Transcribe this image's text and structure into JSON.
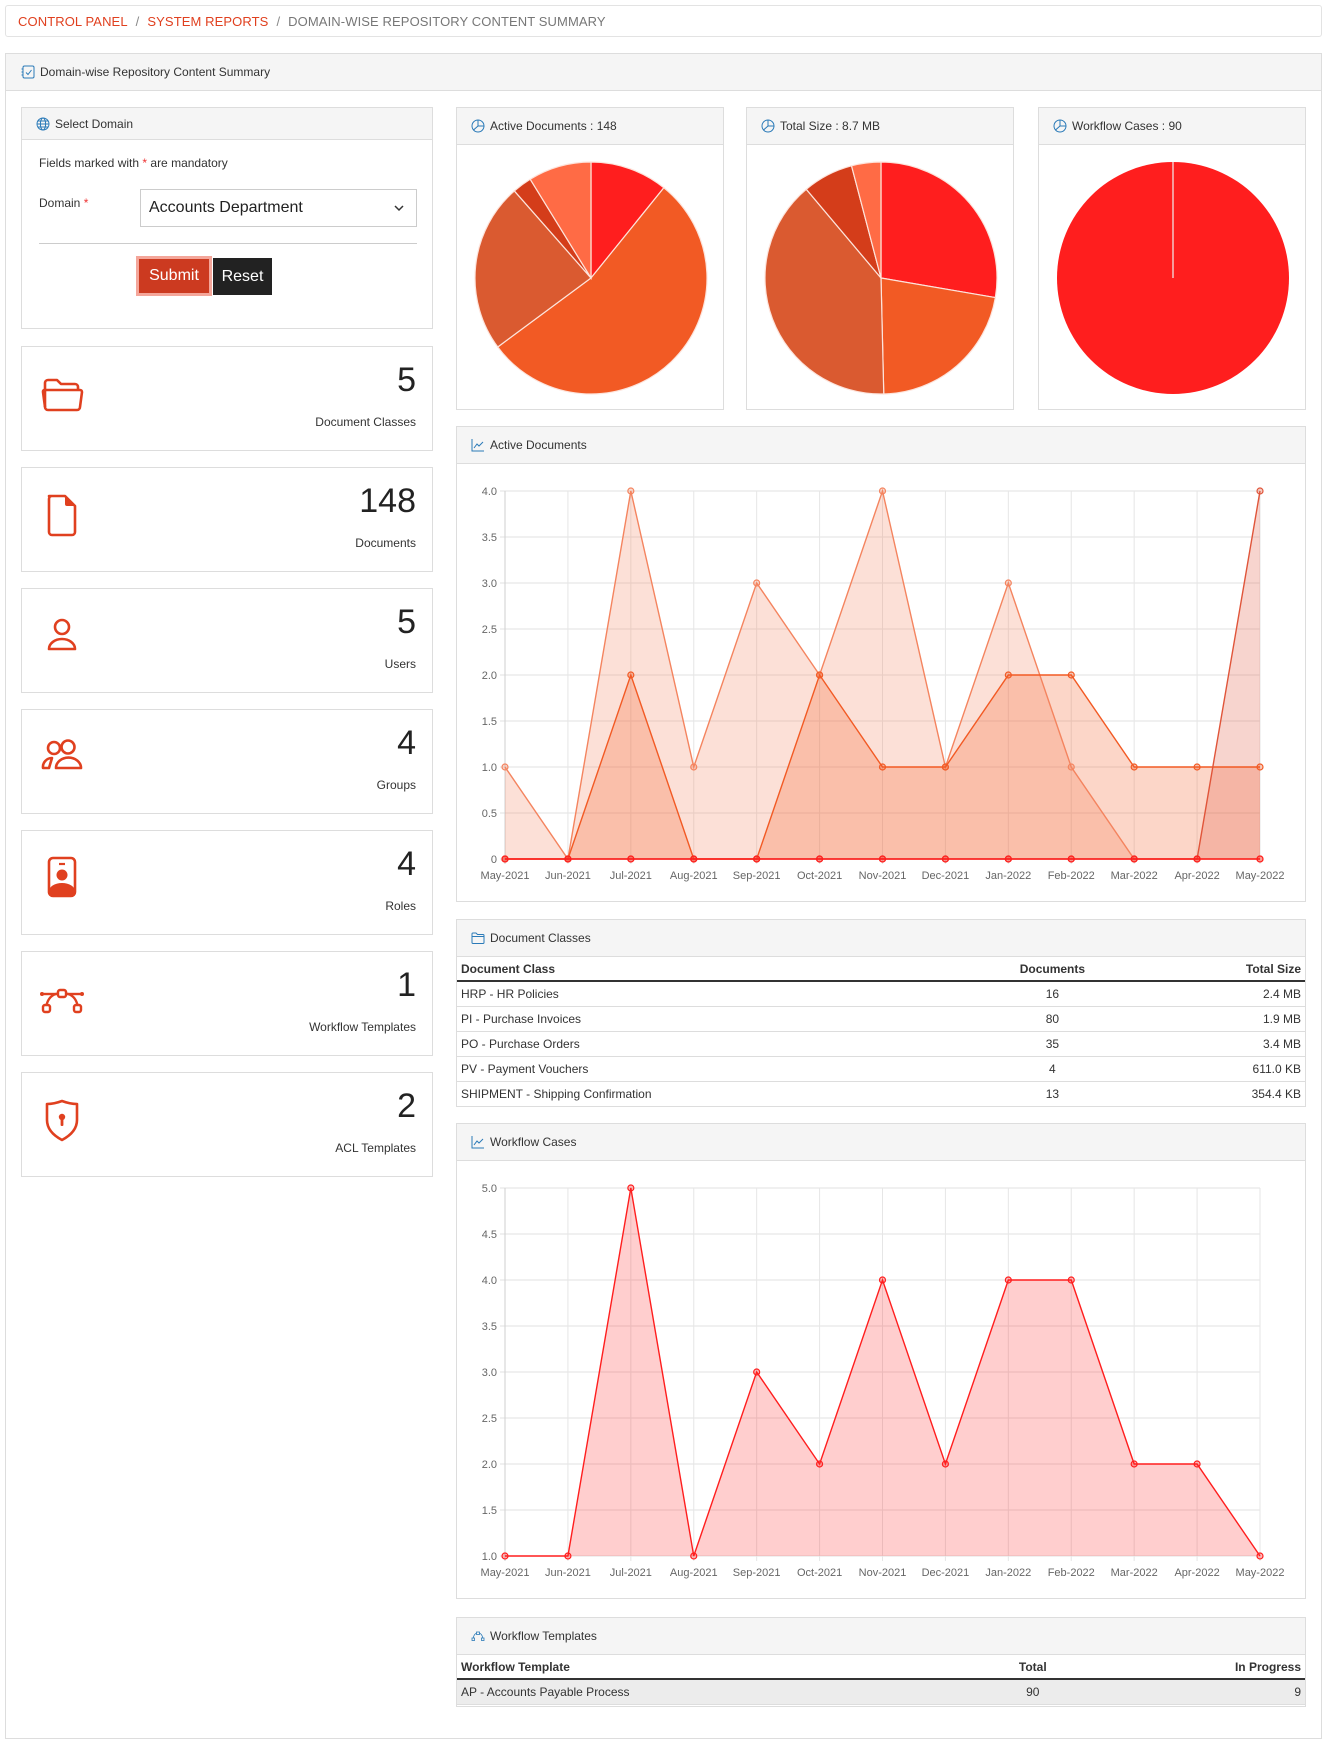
{
  "breadcrumb": {
    "items": [
      "CONTROL PANEL",
      "SYSTEM REPORTS"
    ],
    "current": "DOMAIN-WISE REPOSITORY CONTENT SUMMARY",
    "separator": "/"
  },
  "panel": {
    "title": "Domain-wise Repository Content Summary"
  },
  "domain_form": {
    "title": "Select Domain",
    "mandatory_prefix": "Fields marked with",
    "mandatory_star": "*",
    "mandatory_suffix": "are mandatory",
    "domain_label": "Domain",
    "domain_value": "Accounts Department",
    "submit_label": "Submit",
    "reset_label": "Reset"
  },
  "stats": [
    {
      "icon": "folder-icon",
      "value": "5",
      "label": "Document Classes"
    },
    {
      "icon": "document-icon",
      "value": "148",
      "label": "Documents"
    },
    {
      "icon": "user-icon",
      "value": "5",
      "label": "Users"
    },
    {
      "icon": "group-icon",
      "value": "4",
      "label": "Groups"
    },
    {
      "icon": "role-badge-icon",
      "value": "4",
      "label": "Roles"
    },
    {
      "icon": "workflow-icon",
      "value": "1",
      "label": "Workflow Templates"
    },
    {
      "icon": "shield-lock-icon",
      "value": "2",
      "label": "ACL Templates"
    }
  ],
  "colors": {
    "accent": "#E0401F",
    "icon_blue": "#2A7AB8",
    "palette": [
      "#FF1E1E",
      "#F25A24",
      "#DA5A30",
      "#D43D1A",
      "#FF6B45"
    ]
  },
  "pies": {
    "active_documents": {
      "title": "Active Documents : 148"
    },
    "total_size": {
      "title": "Total Size : 8.7 MB"
    },
    "workflow_cases": {
      "title": "Workflow Cases : 90"
    }
  },
  "charts": {
    "active_documents": {
      "title": "Active Documents"
    },
    "workflow_cases": {
      "title": "Workflow Cases"
    }
  },
  "doc_classes": {
    "title": "Document Classes",
    "columns": [
      "Document Class",
      "Documents",
      "Total Size"
    ],
    "rows": [
      [
        "HRP - HR Policies",
        "16",
        "2.4 MB"
      ],
      [
        "PI - Purchase Invoices",
        "80",
        "1.9 MB"
      ],
      [
        "PO - Purchase Orders",
        "35",
        "3.4 MB"
      ],
      [
        "PV - Payment Vouchers",
        "4",
        "611.0 KB"
      ],
      [
        "SHIPMENT - Shipping Confirmation",
        "13",
        "354.4 KB"
      ]
    ]
  },
  "workflow_templates": {
    "title": "Workflow Templates",
    "columns": [
      "Workflow Template",
      "Total",
      "In Progress"
    ],
    "rows": [
      [
        "AP - Accounts Payable Process",
        "90",
        "9"
      ]
    ]
  },
  "chart_data": [
    {
      "type": "pie",
      "title": "Active Documents : 148",
      "labels": [
        "HRP - HR Policies",
        "PI - Purchase Invoices",
        "PO - Purchase Orders",
        "PV - Payment Vouchers",
        "SHIPMENT - Shipping Confirmation"
      ],
      "values": [
        16,
        80,
        35,
        4,
        13
      ],
      "colors": [
        "#FF1E1E",
        "#F25A24",
        "#DA5A30",
        "#D43D1A",
        "#FF6B45"
      ]
    },
    {
      "type": "pie",
      "title": "Total Size : 8.7 MB",
      "labels": [
        "HRP - HR Policies",
        "PI - Purchase Invoices",
        "PO - Purchase Orders",
        "PV - Payment Vouchers",
        "SHIPMENT - Shipping Confirmation"
      ],
      "values": [
        2.4,
        1.9,
        3.4,
        0.611,
        0.3544
      ],
      "unit": "MB",
      "colors": [
        "#FF1E1E",
        "#F25A24",
        "#DA5A30",
        "#D43D1A",
        "#FF6B45"
      ]
    },
    {
      "type": "pie",
      "title": "Workflow Cases : 90",
      "labels": [
        "AP - Accounts Payable Process"
      ],
      "values": [
        90
      ],
      "colors": [
        "#FF1E1E"
      ]
    },
    {
      "type": "area",
      "title": "Active Documents",
      "x": [
        "May-2021",
        "Jun-2021",
        "Jul-2021",
        "Aug-2021",
        "Sep-2021",
        "Oct-2021",
        "Nov-2021",
        "Dec-2021",
        "Jan-2022",
        "Feb-2022",
        "Mar-2022",
        "Apr-2022",
        "May-2022"
      ],
      "ylim": [
        0,
        4
      ],
      "yticks": [
        "0",
        "0.5",
        "1.0",
        "1.5",
        "2.0",
        "2.5",
        "3.0",
        "3.5",
        "4.0"
      ],
      "grid": true,
      "series": [
        {
          "name": "series-1",
          "color": "#F4845F",
          "values": [
            1,
            0,
            4,
            1,
            3,
            2,
            4,
            1,
            3,
            1,
            0,
            0,
            0
          ]
        },
        {
          "name": "series-2",
          "color": "#F25A24",
          "values": [
            0,
            0,
            2,
            0,
            0,
            2,
            1,
            1,
            2,
            2,
            1,
            1,
            1
          ]
        },
        {
          "name": "series-3",
          "color": "#E0553A",
          "values": [
            0,
            0,
            0,
            0,
            0,
            0,
            0,
            0,
            0,
            0,
            0,
            0,
            4
          ]
        },
        {
          "name": "series-4",
          "color": "#FF1E1E",
          "values": [
            0,
            0,
            0,
            0,
            0,
            0,
            0,
            0,
            0,
            0,
            0,
            0,
            0
          ]
        }
      ]
    },
    {
      "type": "area",
      "title": "Workflow Cases",
      "x": [
        "May-2021",
        "Jun-2021",
        "Jul-2021",
        "Aug-2021",
        "Sep-2021",
        "Oct-2021",
        "Nov-2021",
        "Dec-2021",
        "Jan-2022",
        "Feb-2022",
        "Mar-2022",
        "Apr-2022",
        "May-2022"
      ],
      "ylim": [
        1,
        5
      ],
      "yticks": [
        "1.0",
        "1.5",
        "2.0",
        "2.5",
        "3.0",
        "3.5",
        "4.0",
        "4.5",
        "5.0"
      ],
      "grid": true,
      "series": [
        {
          "name": "AP - Accounts Payable Process",
          "color": "#FF1E1E",
          "values": [
            1,
            1,
            5,
            1,
            3,
            2,
            4,
            2,
            4,
            4,
            2,
            2,
            1
          ]
        }
      ]
    }
  ]
}
